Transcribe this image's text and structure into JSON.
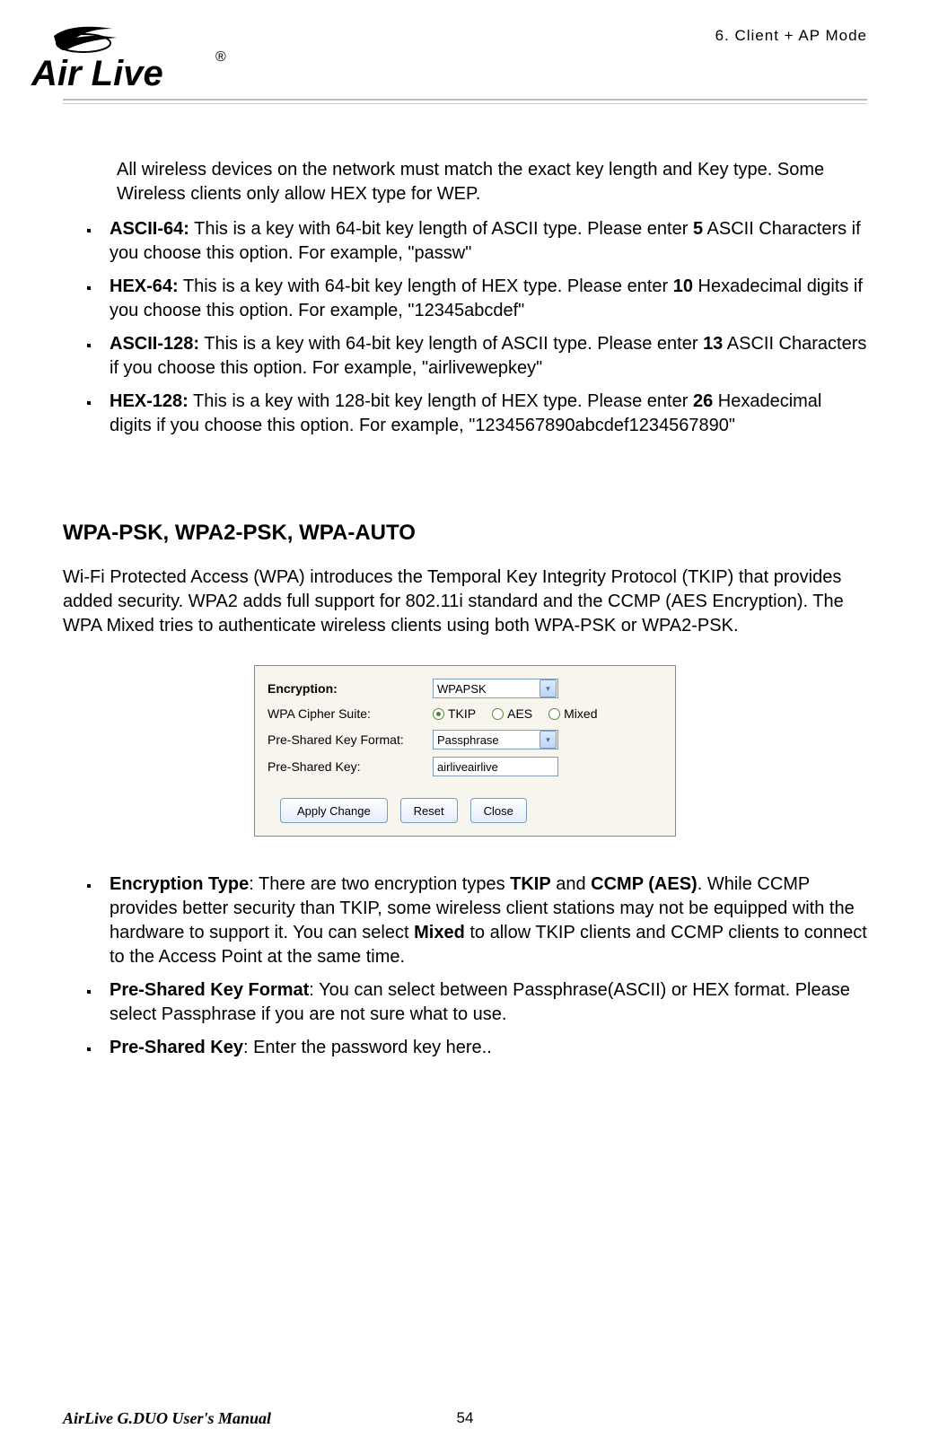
{
  "header": {
    "chapter": "6.   Client + AP Mode"
  },
  "logo": {
    "text": "Air Live",
    "reg": "®"
  },
  "wep": {
    "intro": "All wireless devices on the network must match the exact key length and Key type. Some Wireless clients only allow HEX type for WEP.",
    "items": [
      {
        "bold": "ASCII-64:",
        "text": " This is a key with 64-bit key length of ASCII type.   Please enter ",
        "bold2": "5",
        "tail": " ASCII Characters if you choose this option. For example, \"passw\""
      },
      {
        "bold": "HEX-64:",
        "text": " This is a key with 64-bit key length of HEX type.   Please enter ",
        "bold2": "10",
        "tail": " Hexadecimal digits if you choose this option. For example, \"12345abcdef\""
      },
      {
        "bold": "ASCII-128:",
        "text": " This is a key with 64-bit key length of ASCII type.   Please enter ",
        "bold2": "13",
        "tail": " ASCII Characters if you choose this option. For example, \"airlivewepkey\""
      },
      {
        "bold": "HEX-128:",
        "text": " This is a key with 128-bit key length of HEX type.   Please enter ",
        "bold2": "26",
        "tail": " Hexadecimal digits if you choose this option. For example, \"1234567890abcdef1234567890\""
      }
    ]
  },
  "wpa": {
    "title": "WPA-PSK, WPA2-PSK, WPA-AUTO",
    "desc": "Wi-Fi Protected Access (WPA) introduces the Temporal Key Integrity Protocol (TKIP) that provides added security.   WPA2 adds full support for 802.11i standard and the CCMP (AES Encryption).   The WPA Mixed tries to authenticate wireless clients using both WPA-PSK or WPA2-PSK."
  },
  "dialog": {
    "labels": {
      "encryption": "Encryption:",
      "cipher": "WPA Cipher Suite:",
      "format": "Pre-Shared Key Format:",
      "key": "Pre-Shared Key:"
    },
    "values": {
      "encryption": "WPAPSK",
      "format": "Passphrase",
      "key": "airliveairlive"
    },
    "cipher_options": {
      "tkip": "TKIP",
      "aes": "AES",
      "mixed": "Mixed"
    },
    "buttons": {
      "apply": "Apply Change",
      "reset": "Reset",
      "close": "Close"
    }
  },
  "explain": {
    "items": [
      {
        "bold": "Encryption Type",
        "colon": ":   ",
        "text_pre": "There are two encryption types ",
        "b1": "TKIP",
        "mid": " and ",
        "b2": "CCMP (AES)",
        "text_post": ". While CCMP provides better security than TKIP, some wireless client stations may not be equipped with the hardware to support it. You can select ",
        "b3": "Mixed",
        "tail": " to allow TKIP clients and CCMP clients to connect to the Access Point at the same time."
      },
      {
        "bold": "Pre-Shared Key Format",
        "colon": ":   ",
        "text": "You can select between Passphrase(ASCII) or HEX format.   Please select Passphrase if you are not sure what to use."
      },
      {
        "bold": "Pre-Shared Key",
        "colon": ":   ",
        "text": "Enter the password key here.."
      }
    ]
  },
  "footer": {
    "manual": "AirLive G.DUO User's Manual",
    "page": "54"
  }
}
